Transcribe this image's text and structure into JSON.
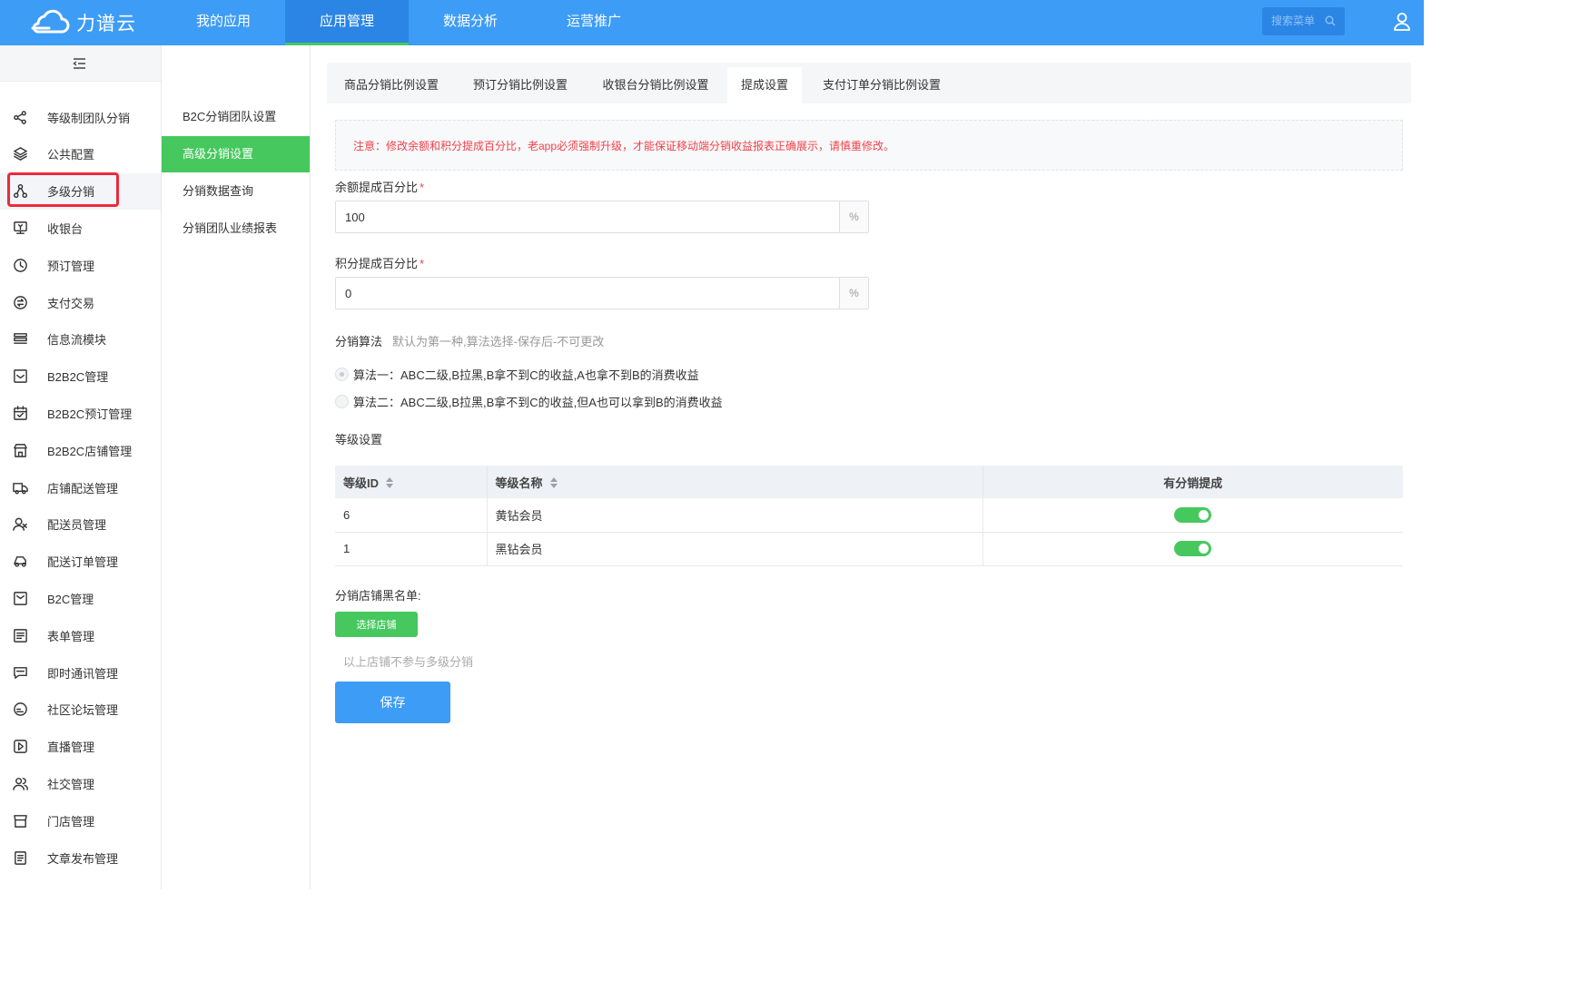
{
  "brand": {
    "logo_text": "力谱云"
  },
  "topnav": {
    "items": [
      {
        "label": "我的应用",
        "active": false
      },
      {
        "label": "应用管理",
        "active": true
      },
      {
        "label": "数据分析",
        "active": false
      },
      {
        "label": "运营推广",
        "active": false
      }
    ],
    "search_placeholder": "搜索菜单"
  },
  "sidebar": {
    "items": [
      {
        "label": "等级制团队分销",
        "icon": "share-icon"
      },
      {
        "label": "公共配置",
        "icon": "layers-icon"
      },
      {
        "label": "多级分销",
        "icon": "hierarchy-icon",
        "active": true
      },
      {
        "label": "收银台",
        "icon": "cash-register-icon"
      },
      {
        "label": "预订管理",
        "icon": "clock-icon"
      },
      {
        "label": "支付交易",
        "icon": "exchange-icon"
      },
      {
        "label": "信息流模块",
        "icon": "feed-icon"
      },
      {
        "label": "B2B2C管理",
        "icon": "inbox-icon"
      },
      {
        "label": "B2B2C预订管理",
        "icon": "calendar-check-icon"
      },
      {
        "label": "B2B2C店铺管理",
        "icon": "store-icon"
      },
      {
        "label": "店铺配送管理",
        "icon": "truck-icon"
      },
      {
        "label": "配送员管理",
        "icon": "courier-icon"
      },
      {
        "label": "配送订单管理",
        "icon": "delivery-icon"
      },
      {
        "label": "B2C管理",
        "icon": "box-icon"
      },
      {
        "label": "表单管理",
        "icon": "form-icon"
      },
      {
        "label": "即时通讯管理",
        "icon": "chat-icon"
      },
      {
        "label": "社区论坛管理",
        "icon": "forum-icon"
      },
      {
        "label": "直播管理",
        "icon": "play-icon"
      },
      {
        "label": "社交管理",
        "icon": "users-icon"
      },
      {
        "label": "门店管理",
        "icon": "shop-icon"
      },
      {
        "label": "文章发布管理",
        "icon": "document-icon"
      }
    ]
  },
  "submenu": {
    "items": [
      {
        "label": "B2C分销团队设置",
        "active": false
      },
      {
        "label": "高级分销设置",
        "active": true
      },
      {
        "label": "分销数据查询",
        "active": false
      },
      {
        "label": "分销团队业绩报表",
        "active": false
      }
    ]
  },
  "tabs": [
    {
      "label": "商品分销比例设置",
      "active": false
    },
    {
      "label": "预订分销比例设置",
      "active": false
    },
    {
      "label": "收银台分销比例设置",
      "active": false
    },
    {
      "label": "提成设置",
      "active": true
    },
    {
      "label": "支付订单分销比例设置",
      "active": false
    }
  ],
  "notice": "注意：修改余额和积分提成百分比，老app必须强制升级，才能保证移动端分销收益报表正确展示，请慎重修改。",
  "form": {
    "balance": {
      "label": "余额提成百分比",
      "required_mark": "*",
      "value": "100",
      "unit": "%"
    },
    "points": {
      "label": "积分提成百分比",
      "required_mark": "*",
      "value": "0",
      "unit": "%"
    },
    "algorithm": {
      "label": "分销算法",
      "hint": "默认为第一种,算法选择-保存后-不可更改",
      "options": [
        {
          "label": "算法一：ABC二级,B拉黑,B拿不到C的收益,A也拿不到B的消费收益",
          "checked": true
        },
        {
          "label": "算法二：ABC二级,B拉黑,B拿不到C的收益,但A也可以拿到B的消费收益",
          "checked": false
        }
      ]
    },
    "grade": {
      "label": "等级设置",
      "columns": [
        "等级ID",
        "等级名称",
        "有分销提成"
      ],
      "rows": [
        {
          "id": "6",
          "name": "黄钻会员",
          "enabled": true
        },
        {
          "id": "1",
          "name": "黑钻会员",
          "enabled": true
        }
      ]
    },
    "blacklist": {
      "label": "分销店铺黑名单:",
      "select_button": "选择店铺",
      "hint": "以上店铺不参与多级分销"
    },
    "save_button": "保存"
  },
  "colors": {
    "primary": "#3d9cf5",
    "primary_dark": "#2b85e4",
    "success": "#46c85e",
    "danger": "#f0424a",
    "highlight": "#ec2a3c"
  }
}
